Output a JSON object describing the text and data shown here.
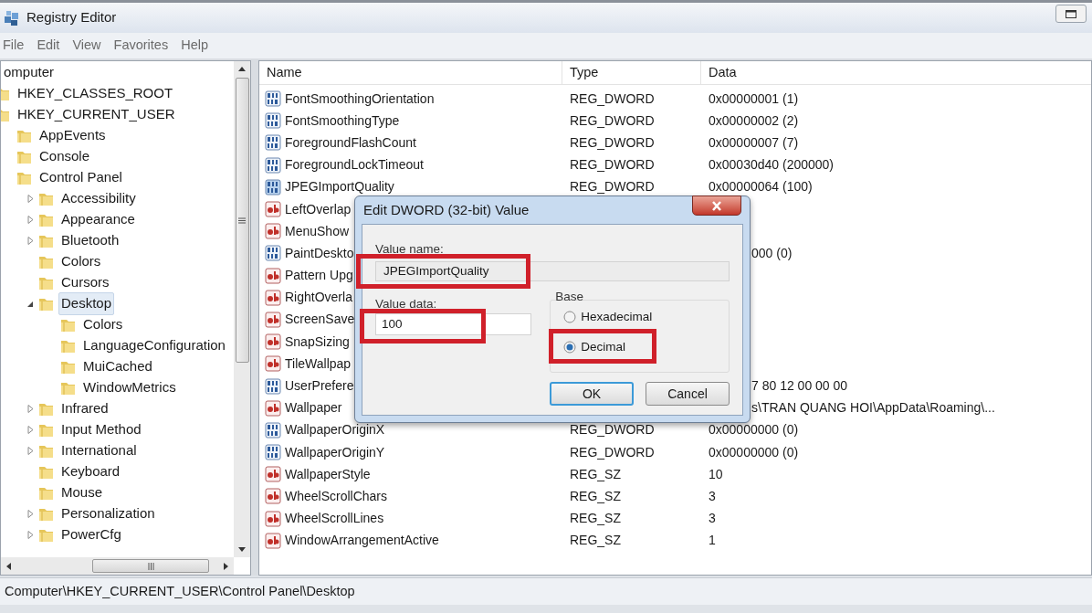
{
  "window": {
    "title": "Registry Editor"
  },
  "menu": [
    "File",
    "Edit",
    "View",
    "Favorites",
    "Help"
  ],
  "tree": [
    {
      "label": "omputer",
      "kind": "root",
      "selected": false,
      "children": [
        {
          "label": "HKEY_CLASSES_ROOT",
          "kind": "key",
          "selected": false
        },
        {
          "label": "HKEY_CURRENT_USER",
          "kind": "key",
          "selected": false,
          "children": [
            {
              "label": "AppEvents",
              "kind": "key",
              "selected": false
            },
            {
              "label": "Console",
              "kind": "key",
              "selected": false
            },
            {
              "label": "Control Panel",
              "kind": "key",
              "selected": false,
              "children": [
                {
                  "label": "Accessibility",
                  "kind": "key",
                  "expanded": false,
                  "selected": false
                },
                {
                  "label": "Appearance",
                  "kind": "key",
                  "expanded": false,
                  "selected": false
                },
                {
                  "label": "Bluetooth",
                  "kind": "key",
                  "expanded": false,
                  "selected": false
                },
                {
                  "label": "Colors",
                  "kind": "key",
                  "selected": false
                },
                {
                  "label": "Cursors",
                  "kind": "key",
                  "selected": false
                },
                {
                  "label": "Desktop",
                  "kind": "key",
                  "expanded": true,
                  "selected": true,
                  "children": [
                    {
                      "label": "Colors",
                      "kind": "key",
                      "selected": false
                    },
                    {
                      "label": "LanguageConfiguration",
                      "kind": "key",
                      "selected": false
                    },
                    {
                      "label": "MuiCached",
                      "kind": "key",
                      "selected": false
                    },
                    {
                      "label": "WindowMetrics",
                      "kind": "key",
                      "selected": false
                    }
                  ]
                },
                {
                  "label": "Infrared",
                  "kind": "key",
                  "expanded": false,
                  "selected": false
                },
                {
                  "label": "Input Method",
                  "kind": "key",
                  "expanded": false,
                  "selected": false
                },
                {
                  "label": "International",
                  "kind": "key",
                  "expanded": false,
                  "selected": false
                },
                {
                  "label": "Keyboard",
                  "kind": "key",
                  "selected": false
                },
                {
                  "label": "Mouse",
                  "kind": "key",
                  "selected": false
                },
                {
                  "label": "Personalization",
                  "kind": "key",
                  "expanded": false,
                  "selected": false
                },
                {
                  "label": "PowerCfg",
                  "kind": "key",
                  "expanded": false,
                  "selected": false
                }
              ]
            }
          ]
        }
      ]
    }
  ],
  "table": {
    "columns": [
      "Name",
      "Type",
      "Data"
    ],
    "rows": [
      {
        "kind": "binary",
        "name": "FontSmoothingOrientation",
        "type": "REG_DWORD",
        "data": "0x00000001 (1)"
      },
      {
        "kind": "binary",
        "name": "FontSmoothingType",
        "type": "REG_DWORD",
        "data": "0x00000002 (2)"
      },
      {
        "kind": "binary",
        "name": "ForegroundFlashCount",
        "type": "REG_DWORD",
        "data": "0x00000007 (7)"
      },
      {
        "kind": "binary",
        "name": "ForegroundLockTimeout",
        "type": "REG_DWORD",
        "data": "0x00030d40 (200000)"
      },
      {
        "kind": "binary",
        "name": "JPEGImportQuality",
        "type": "REG_DWORD",
        "data": "0x00000064 (100)"
      },
      {
        "kind": "string",
        "name": "LeftOverlap"
      },
      {
        "kind": "string",
        "name": "MenuShow"
      },
      {
        "kind": "binary",
        "name": "PaintDeskto",
        "data_tail": "000 (0)"
      },
      {
        "kind": "string",
        "name": "Pattern Upg"
      },
      {
        "kind": "string",
        "name": "RightOverla"
      },
      {
        "kind": "string",
        "name": "ScreenSave"
      },
      {
        "kind": "string",
        "name": "SnapSizing"
      },
      {
        "kind": "string",
        "name": "TileWallpap"
      },
      {
        "kind": "binary",
        "name": "UserPrefere",
        "data_tail": "7 80 12 00 00 00"
      },
      {
        "kind": "string",
        "name": "Wallpaper",
        "data_tail": "s\\TRAN QUANG HOI\\AppData\\Roaming\\..."
      },
      {
        "kind": "binary",
        "name": "WallpaperOriginX",
        "type": "REG_DWORD",
        "data": "0x00000000 (0)"
      },
      {
        "kind": "binary",
        "name": "WallpaperOriginY",
        "type": "REG_DWORD",
        "data": "0x00000000 (0)"
      },
      {
        "kind": "string",
        "name": "WallpaperStyle",
        "type": "REG_SZ",
        "data": "10"
      },
      {
        "kind": "string",
        "name": "WheelScrollChars",
        "type": "REG_SZ",
        "data": "3"
      },
      {
        "kind": "string",
        "name": "WheelScrollLines",
        "type": "REG_SZ",
        "data": "3"
      },
      {
        "kind": "string",
        "name": "WindowArrangementActive",
        "type": "REG_SZ",
        "data": "1"
      }
    ]
  },
  "dialog": {
    "title": "Edit DWORD (32-bit) Value",
    "value_name": {
      "label": "Value name:",
      "value": "JPEGImportQuality",
      "highlighted": true
    },
    "value_data": {
      "label": "Value data:",
      "value": "100",
      "highlighted": true
    },
    "base": {
      "label": "Base",
      "options": [
        {
          "label": "Hexadecimal",
          "selected": false,
          "highlighted": false
        },
        {
          "label": "Decimal",
          "selected": true,
          "highlighted": true
        }
      ]
    },
    "buttons": [
      {
        "label": "OK",
        "focused": true
      },
      {
        "label": "Cancel",
        "focused": false
      }
    ]
  },
  "status_bar": "Computer\\HKEY_CURRENT_USER\\Control Panel\\Desktop"
}
